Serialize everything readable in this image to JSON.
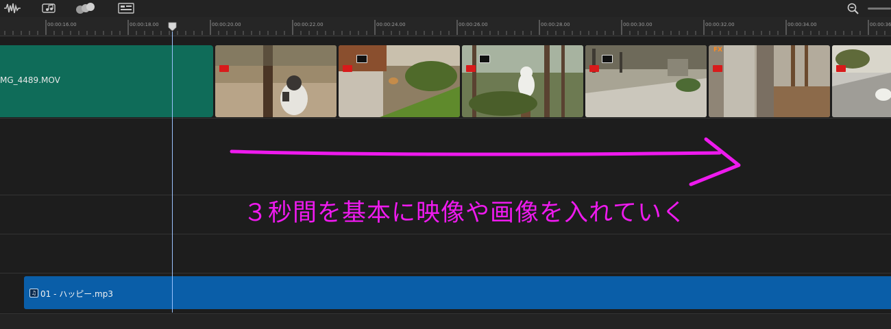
{
  "toolbar": {
    "icons": [
      "waveform-icon",
      "music-notes-icon",
      "spheres-icon",
      "title-card-icon"
    ],
    "zoom_icon": "zoom-out-icon"
  },
  "ruler": {
    "ticks": [
      {
        "label": "00:00:16.00"
      },
      {
        "label": "00:00:18.00"
      },
      {
        "label": "00:00:20.00"
      },
      {
        "label": "00:00:22.00"
      },
      {
        "label": "00:00:24.00"
      },
      {
        "label": "00:00:26.00"
      },
      {
        "label": "00:00:28.00"
      },
      {
        "label": "00:00:30.00"
      },
      {
        "label": "00:00:32.00"
      },
      {
        "label": "00:00:34.00"
      },
      {
        "label": "00:00:36"
      }
    ]
  },
  "video_track": {
    "clip_label": "MG_4489.MOV",
    "clip_color": "#0f6c59"
  },
  "audio_track": {
    "clip_label": "01 - ハッピー.mp3",
    "clip_color": "#0a5ea8"
  },
  "annotation": {
    "text": "３秒間を基本に映像や画像を入れていく",
    "color": "#ee1aee"
  },
  "fx_label": "FX"
}
